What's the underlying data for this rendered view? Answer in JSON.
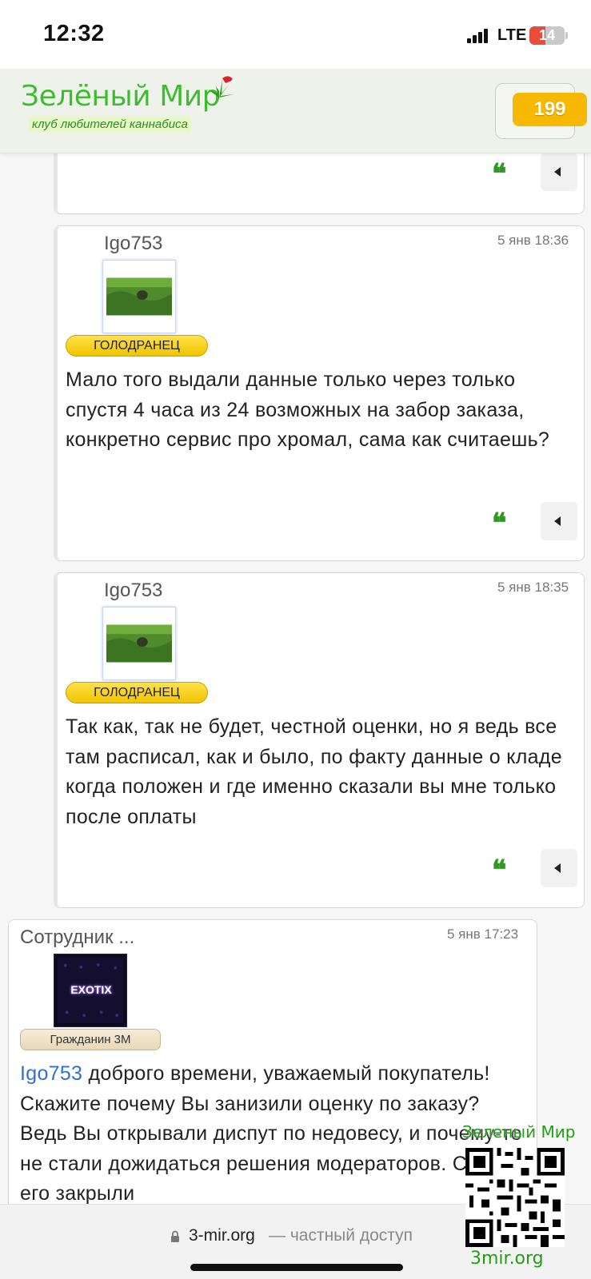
{
  "status_bar": {
    "time": "12:32",
    "network": "LTE",
    "battery": "14",
    "battery_level_percent": 14,
    "signal_icon": "signal-bars-icon"
  },
  "header": {
    "logo_title": "Зелёный Мир",
    "logo_subtitle": "клуб любителей каннабиса",
    "notifications_count": "199",
    "brand_color": "#3cbd2c",
    "badge_color": "#f6b800"
  },
  "posts": [
    {
      "author": "Igo753",
      "date": "5 янв 18:36",
      "rank": "ГОЛОДРАНЕЦ",
      "text": "Мало того выдали данные только через только спустя 4 часа из 24 возможных на забор заказа, конкретно сервис про хромал, сама как считаешь?"
    },
    {
      "author": "Igo753",
      "date": "5 янв 18:35",
      "rank": "ГОЛОДРАНЕЦ",
      "text": "Так как, так не будет, честной оценки, но я ведь все там расписал, как и было, по факту данные о кладе когда положен и где именно сказали вы мне только после оплаты"
    },
    {
      "author": "Сотрудник ...",
      "date": "5 янв 17:23",
      "rank": "Гражданин 3М",
      "avatar_text": "EXOTIX",
      "mention": "Igo753",
      "text": " доброго времени, уважаемый покупатель! Скажите почему Вы занизили оценку по заказу? Ведь Вы открывали диспут по недовесу, и почему-то не стали дожидаться решения модераторов. Сами его закрыли"
    }
  ],
  "actions": {
    "quote_glyph": "❝",
    "quote_color": "#2d9a22"
  },
  "watermark": {
    "title": "Зеленый Мир",
    "url": "3mir.org"
  },
  "address_bar": {
    "host": "3-mir.org",
    "note": "— частный доступ"
  }
}
